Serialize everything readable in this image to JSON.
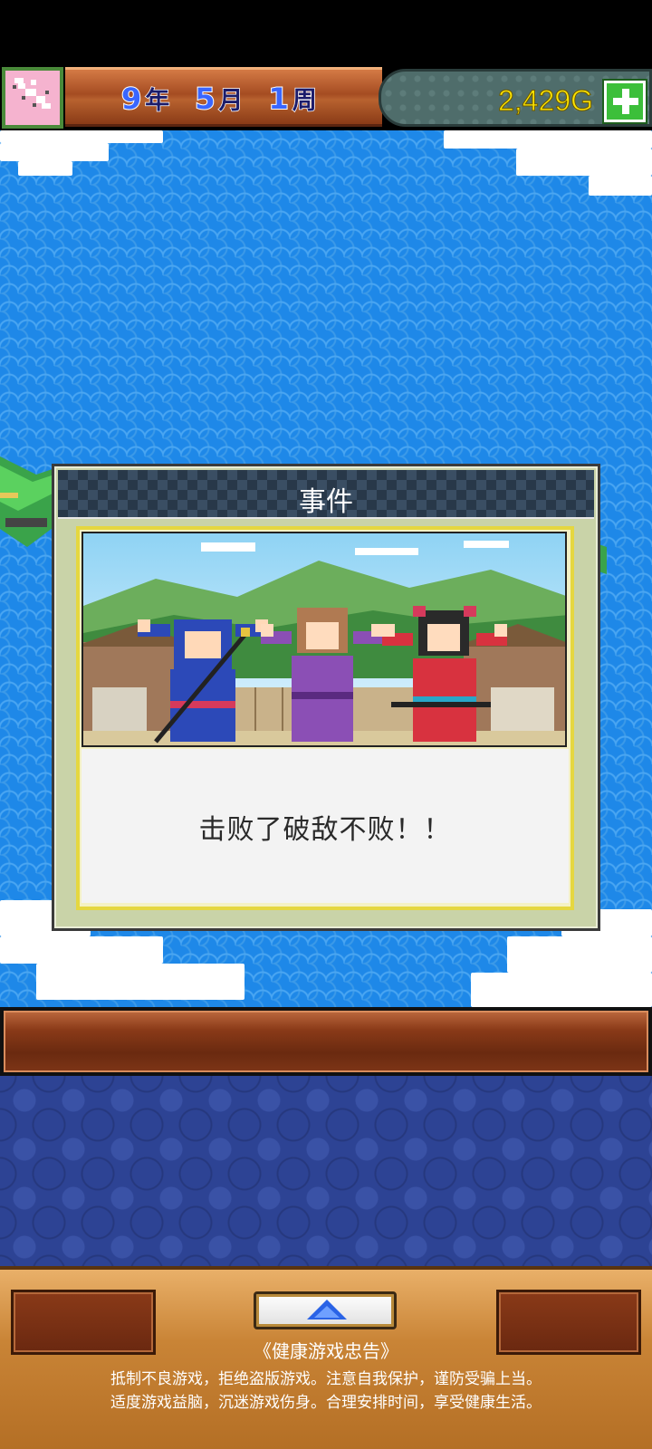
{
  "hud": {
    "year_value": "9",
    "year_unit": "年",
    "month_value": "5",
    "month_unit": "月",
    "week_value": "1",
    "week_unit": "周",
    "gold": "2,429G",
    "plus_icon": "plus-icon",
    "avatar_icon": "sakura-icon"
  },
  "dialog": {
    "title": "事件",
    "message": "击败了破敌不败！！",
    "scene": "three-ninjas-celebrating"
  },
  "bottom": {
    "up_icon": "up-arrow-icon",
    "notice_title": "《健康游戏忠告》",
    "notice_line1": "抵制不良游戏，拒绝盗版游戏。注意自我保护，谨防受骗上当。",
    "notice_line2": "适度游戏益脑，沉迷游戏伤身。合理安排时间，享受健康生活。"
  },
  "colors": {
    "sea": "#1e88e8",
    "gold_text": "#ffe600",
    "date_number": "#3a66ff",
    "dialog_frame": "#c9d3a8"
  }
}
